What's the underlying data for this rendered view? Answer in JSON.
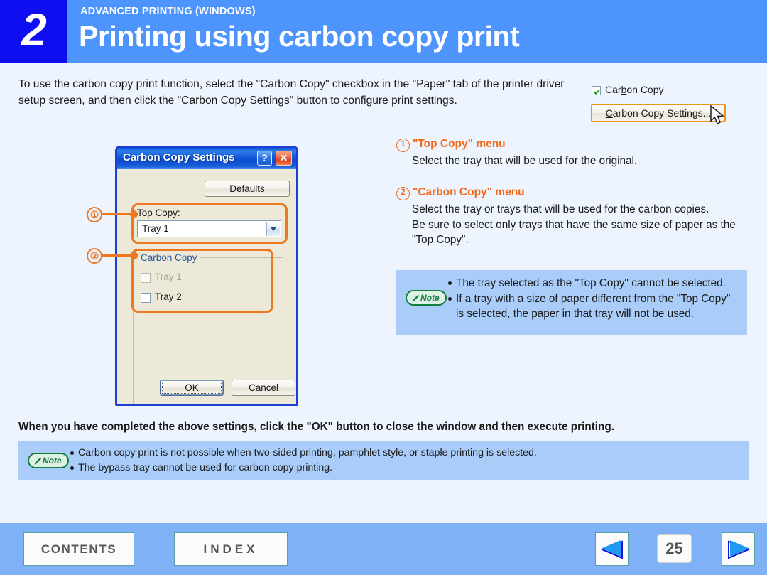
{
  "header": {
    "chapter_number": "2",
    "eyebrow": "ADVANCED PRINTING (WINDOWS)",
    "title": "Printing using carbon copy print",
    "chapter_block_color": "#0e0ef0",
    "band_color": "#4d95fc"
  },
  "intro": {
    "text": "To use the carbon copy print function, select the \"Carbon Copy\" checkbox in the \"Paper\" tab of the printer driver setup screen, and then click the \"Carbon Copy Settings\" button to configure print settings."
  },
  "snippet": {
    "checkbox_label_pre": "Car",
    "checkbox_label_acc": "b",
    "checkbox_label_post": "on Copy",
    "checkbox_checked": true,
    "button_acc": "C",
    "button_label_post": "arbon Copy Settings...",
    "highlight_color": "#e8941d"
  },
  "dialog": {
    "title": "Carbon Copy Settings",
    "help_glyph": "?",
    "close_glyph": "✕",
    "defaults_pre": "De",
    "defaults_acc": "f",
    "defaults_post": "aults",
    "top_copy_pre": "T",
    "top_copy_acc": "o",
    "top_copy_post": "p Copy:",
    "top_copy_value": "Tray 1",
    "group_legend": "Carbon Copy",
    "checkboxes": [
      {
        "label_pre": "Tray ",
        "label_acc": "1",
        "checked": false,
        "disabled": true
      },
      {
        "label_pre": "Tray ",
        "label_acc": "2",
        "checked": false,
        "disabled": false
      }
    ],
    "ok_label": "OK",
    "cancel_label": "Cancel",
    "border_color": "#1d3fd4",
    "highlight_color": "#ee7722"
  },
  "callouts": [
    {
      "number": "①"
    },
    {
      "number": "②"
    }
  ],
  "explanations": [
    {
      "number": "1",
      "heading": "\"Top Copy\" menu",
      "body": "Select the tray that will be used for the original."
    },
    {
      "number": "2",
      "heading": "\"Carbon Copy\" menu",
      "body": "Select the tray or trays that will be used for the carbon copies.\nBe sure to select only trays that have the same size of paper as the \"Top Copy\"."
    }
  ],
  "note_right": {
    "icon_label": "Note",
    "items": [
      "The tray selected as the \"Top Copy\" cannot be selected.",
      "If a tray with a size of paper different from the \"Top Copy\" is selected, the paper in that tray will not be used."
    ]
  },
  "bold_line": {
    "text": "When you have completed the above settings, click the \"OK\" button to close the window and then execute printing."
  },
  "note_bottom": {
    "icon_label": "Note",
    "items": [
      "Carbon copy print is not possible when two-sided printing, pamphlet style, or staple printing is selected.",
      "The bypass tray cannot be used for carbon copy printing."
    ]
  },
  "footer": {
    "contents_label": "CONTENTS",
    "index_label": "INDEX",
    "page_number": "25",
    "bar_color": "#7fb1f7"
  }
}
